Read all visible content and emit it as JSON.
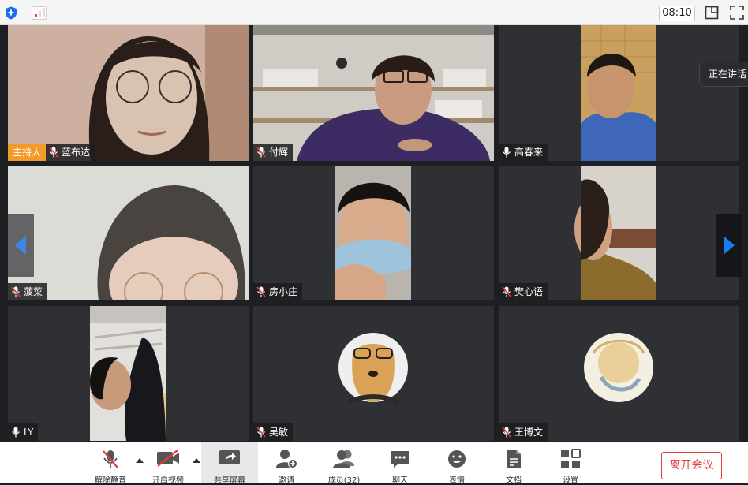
{
  "topbar": {
    "timer": "08:10",
    "icons": [
      "shield-icon",
      "signal-strength-icon",
      "layout-icon",
      "fullscreen-icon"
    ]
  },
  "speaking_indicator": "正在讲话",
  "participants": [
    {
      "name": "蓝布达",
      "role": "主持人",
      "muted": true
    },
    {
      "name": "付辉",
      "muted": true
    },
    {
      "name": "高春来",
      "muted": false
    },
    {
      "name": "菠菜",
      "muted": true
    },
    {
      "name": "房小庄",
      "muted": true
    },
    {
      "name": "樊心语",
      "muted": true
    },
    {
      "name": "LY",
      "muted": false
    },
    {
      "name": "吴敏",
      "muted": true
    },
    {
      "name": "王博文",
      "muted": true
    }
  ],
  "toolbar": {
    "unmute": "解除静音",
    "start_video": "开启视频",
    "share_screen": "共享屏幕",
    "invite": "邀请",
    "members": "成员(32)",
    "chat": "聊天",
    "emoji": "表情",
    "docs": "文档",
    "settings": "设置",
    "leave": "离开会议"
  },
  "colors": {
    "host_badge": "#f29b2a",
    "leave_red": "#e03d3d",
    "nav_arrow_blue": "#1a7cf0",
    "mute_red": "#e03d3d"
  }
}
